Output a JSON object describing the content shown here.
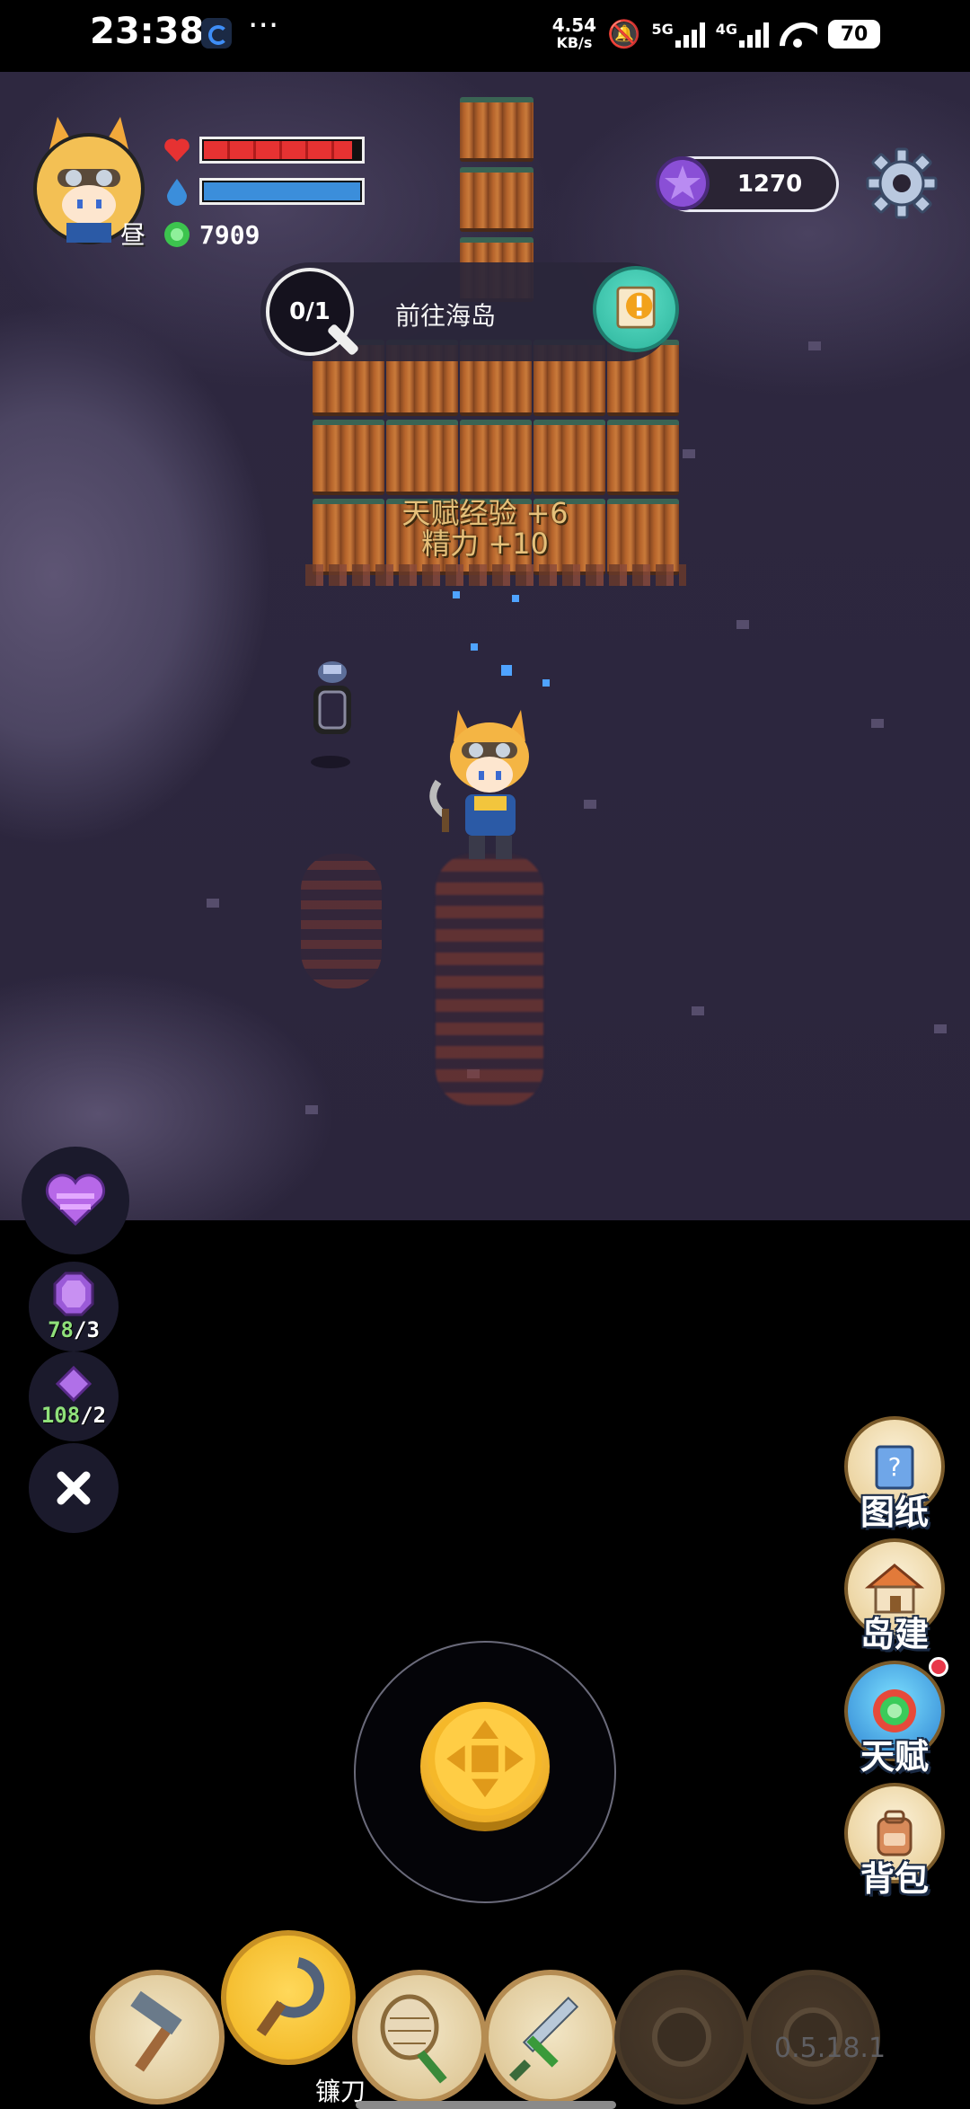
{
  "status_bar": {
    "time": "23:38",
    "more": "···",
    "net_speed_value": "4.54",
    "net_speed_unit": "KB/s",
    "network_5g": "5G",
    "network_4g": "4G",
    "battery": "70"
  },
  "player": {
    "day_label": "昼",
    "health_fraction": 0.95,
    "stamina_fraction": 1.0,
    "coins": "7909"
  },
  "currency": {
    "gems": "1270"
  },
  "quest": {
    "progress": "0/1",
    "title": "前往海岛"
  },
  "world": {
    "floating_line1": "天赋经验 +6",
    "floating_line2": "精力 +10"
  },
  "left_panel": {
    "crystal_count": "78",
    "crystal_required": "/3",
    "shard_count": "108",
    "shard_required": "/2"
  },
  "side_menu": [
    {
      "label": "图纸",
      "icon": "blueprint-icon"
    },
    {
      "label": "岛建",
      "icon": "island-build-icon"
    },
    {
      "label": "天赋",
      "icon": "talent-icon"
    },
    {
      "label": "背包",
      "icon": "backpack-icon"
    }
  ],
  "hotbar": {
    "active_label": "镰刀",
    "slots": [
      "hammer-icon",
      "sickle-icon",
      "net-icon",
      "sword-icon",
      "locked-slot-icon",
      "locked-slot-icon"
    ]
  },
  "version": "0.5.18.1",
  "colors": {
    "health": "#e63232",
    "stamina": "#3b8edb",
    "gem": "#8a4fd6",
    "coin": "#3cc44e",
    "ocean": "#2e2840"
  }
}
